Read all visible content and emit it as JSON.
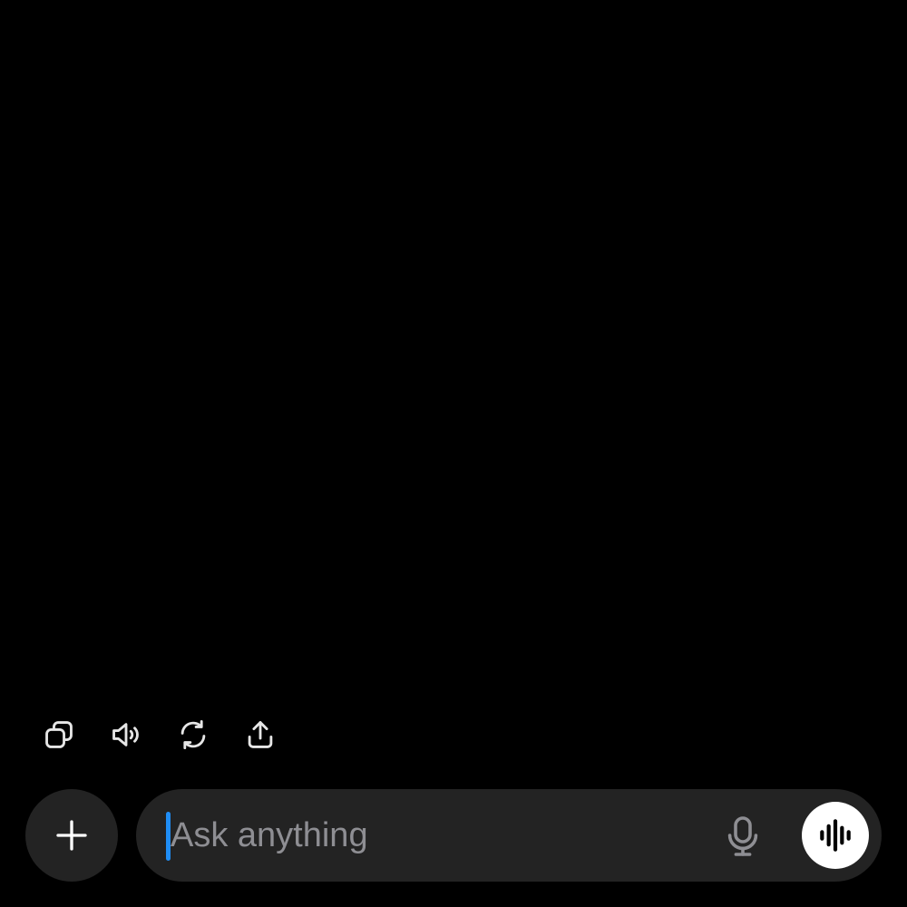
{
  "composer": {
    "placeholder": "Ask anything"
  },
  "message_actions": [
    {
      "name": "copy",
      "icon": "copy-icon"
    },
    {
      "name": "read-aloud",
      "icon": "speaker-icon"
    },
    {
      "name": "regenerate",
      "icon": "refresh-icon"
    },
    {
      "name": "share",
      "icon": "share-icon"
    }
  ],
  "icons": {
    "add": "plus-icon",
    "dictate": "microphone-icon",
    "voice_mode": "waveform-icon"
  },
  "colors": {
    "background": "#000000",
    "surface": "#232323",
    "caret": "#1f8df5",
    "placeholder": "#8e8e93",
    "icon": "#e6e6e6"
  }
}
